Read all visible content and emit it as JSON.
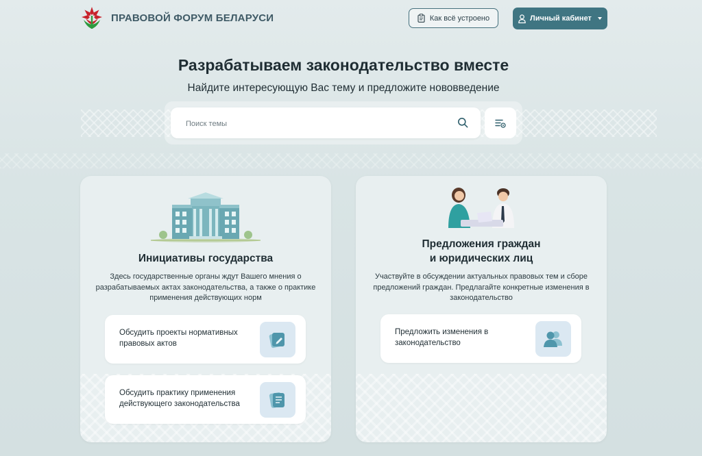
{
  "header": {
    "brand": "ПРАВОВОЙ ФОРУМ БЕЛАРУСИ",
    "how_it_works": "Как всё устроено",
    "cabinet": "Личный кабинет"
  },
  "hero": {
    "title": "Разрабатываем законодательство вместе",
    "subtitle": "Найдите интересующую Вас тему и предложите нововведение"
  },
  "search": {
    "placeholder": "Поиск темы"
  },
  "cards": {
    "state": {
      "title": "Инициативы государства",
      "description": "Здесь государственные органы ждут Вашего мнения о разрабатываемых актах законодательства, а также о практике применения действующих норм",
      "actions": [
        {
          "label": "Обсудить проекты нормативных правовых актов",
          "icon": "edit-document-icon"
        },
        {
          "label": "Обсудить практику применения действующего законодательства",
          "icon": "documents-icon"
        }
      ]
    },
    "citizens": {
      "title_line1": "Предложения граждан",
      "title_line2": "и юридических лиц",
      "description": "Участвуйте в обсуждении актуальных правовых тем и сборе предложений граждан. Предлагайте конкретные изменения в законодательство",
      "actions": [
        {
          "label": "Предложить изменения в законодательство",
          "icon": "users-icon"
        }
      ]
    }
  },
  "colors": {
    "accent": "#3f7582",
    "brand_text": "#3f5a66",
    "background": "#dde7e8",
    "card": "#e8eff0",
    "icon_bg": "#dbe8f2",
    "icon_fill": "#5fa3b6"
  }
}
